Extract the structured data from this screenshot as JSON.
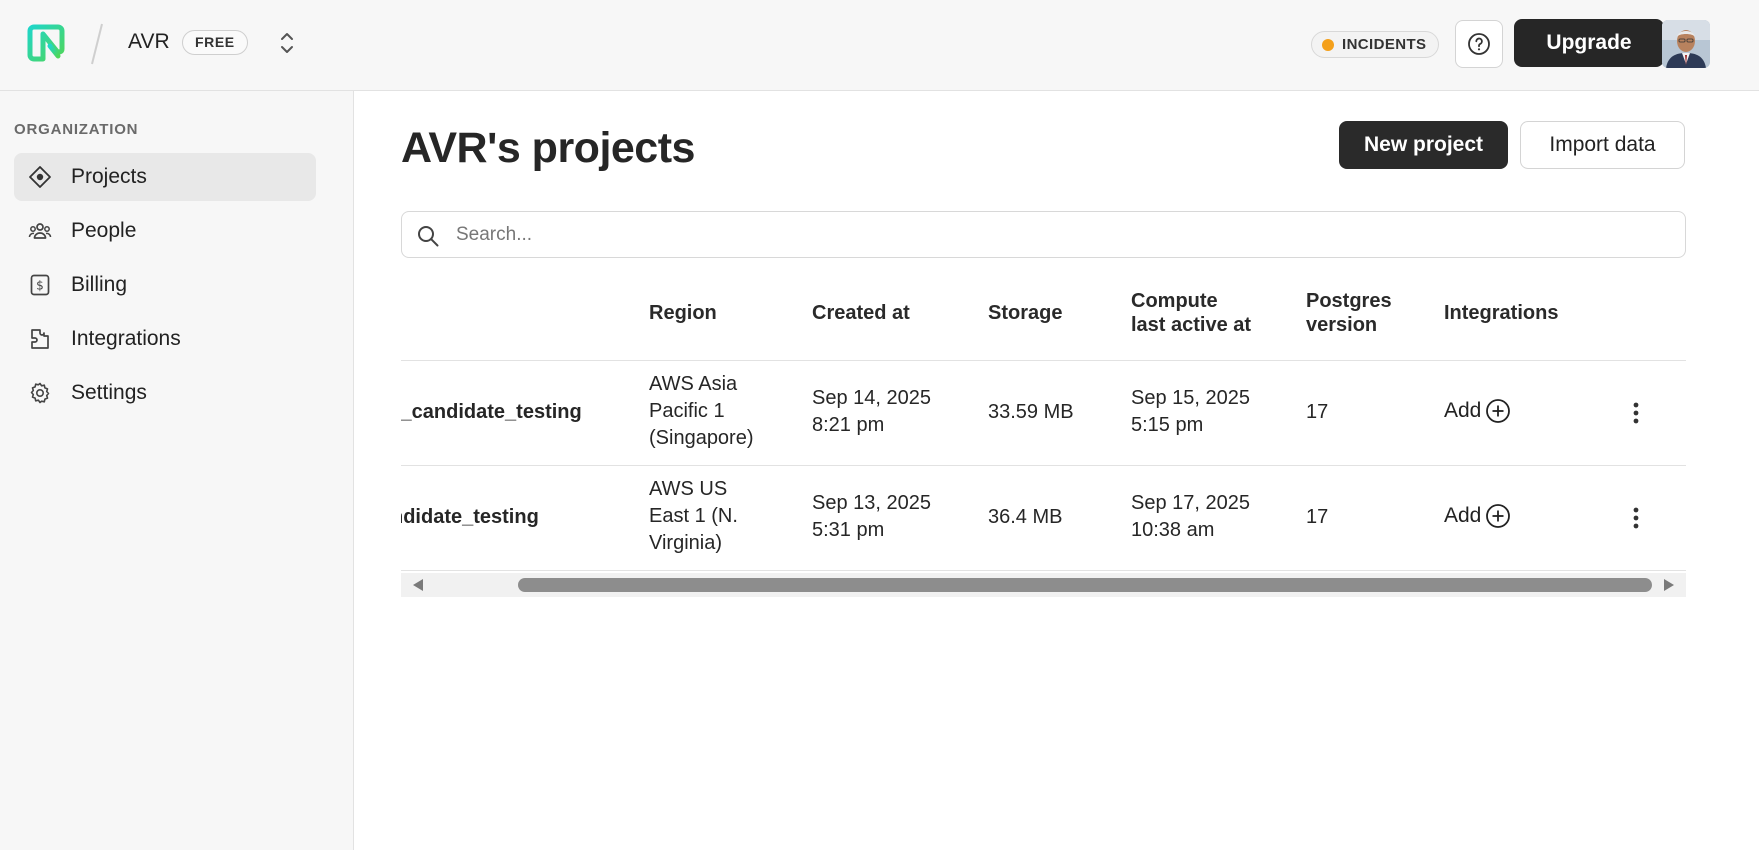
{
  "header": {
    "org_name": "AVR",
    "plan_badge": "FREE",
    "incidents_label": "INCIDENTS",
    "help_icon": "question-circle-icon",
    "upgrade_label": "Upgrade",
    "colors": {
      "incident_dot": "#f4a01b",
      "brand_green": "#37c38f",
      "brand_teal": "#1fc7c7"
    }
  },
  "sidebar": {
    "section_label": "ORGANIZATION",
    "items": [
      {
        "label": "Projects",
        "icon": "projects-icon",
        "active": true
      },
      {
        "label": "People",
        "icon": "people-icon",
        "active": false
      },
      {
        "label": "Billing",
        "icon": "billing-icon",
        "active": false
      },
      {
        "label": "Integrations",
        "icon": "integrations-icon",
        "active": false
      },
      {
        "label": "Settings",
        "icon": "gear-icon",
        "active": false
      }
    ]
  },
  "main": {
    "title": "AVR's projects",
    "new_project_label": "New project",
    "import_data_label": "Import data",
    "search_placeholder": "Search..."
  },
  "table": {
    "headers": {
      "region": "Region",
      "created_at": "Created at",
      "storage": "Storage",
      "compute_line1": "Compute",
      "compute_line2": "last active at",
      "postgres_line1": "Postgres",
      "postgres_line2": "version",
      "integrations": "Integrations"
    },
    "rows": [
      {
        "name": "l_candidate_testing",
        "region": [
          "AWS Asia",
          "Pacific 1",
          "(Singapore)"
        ],
        "created": [
          "Sep 14, 2025",
          "8:21 pm"
        ],
        "storage": "33.59 MB",
        "compute": [
          "Sep 15, 2025",
          "5:15 pm"
        ],
        "postgres": "17",
        "integrations": "Add"
      },
      {
        "name": "ndidate_testing",
        "region": [
          "AWS US",
          "East 1 (N.",
          "Virginia)"
        ],
        "created": [
          "Sep 13, 2025",
          "5:31 pm"
        ],
        "storage": "36.4 MB",
        "compute": [
          "Sep 17, 2025",
          "10:38 am"
        ],
        "postgres": "17",
        "integrations": "Add"
      }
    ]
  }
}
